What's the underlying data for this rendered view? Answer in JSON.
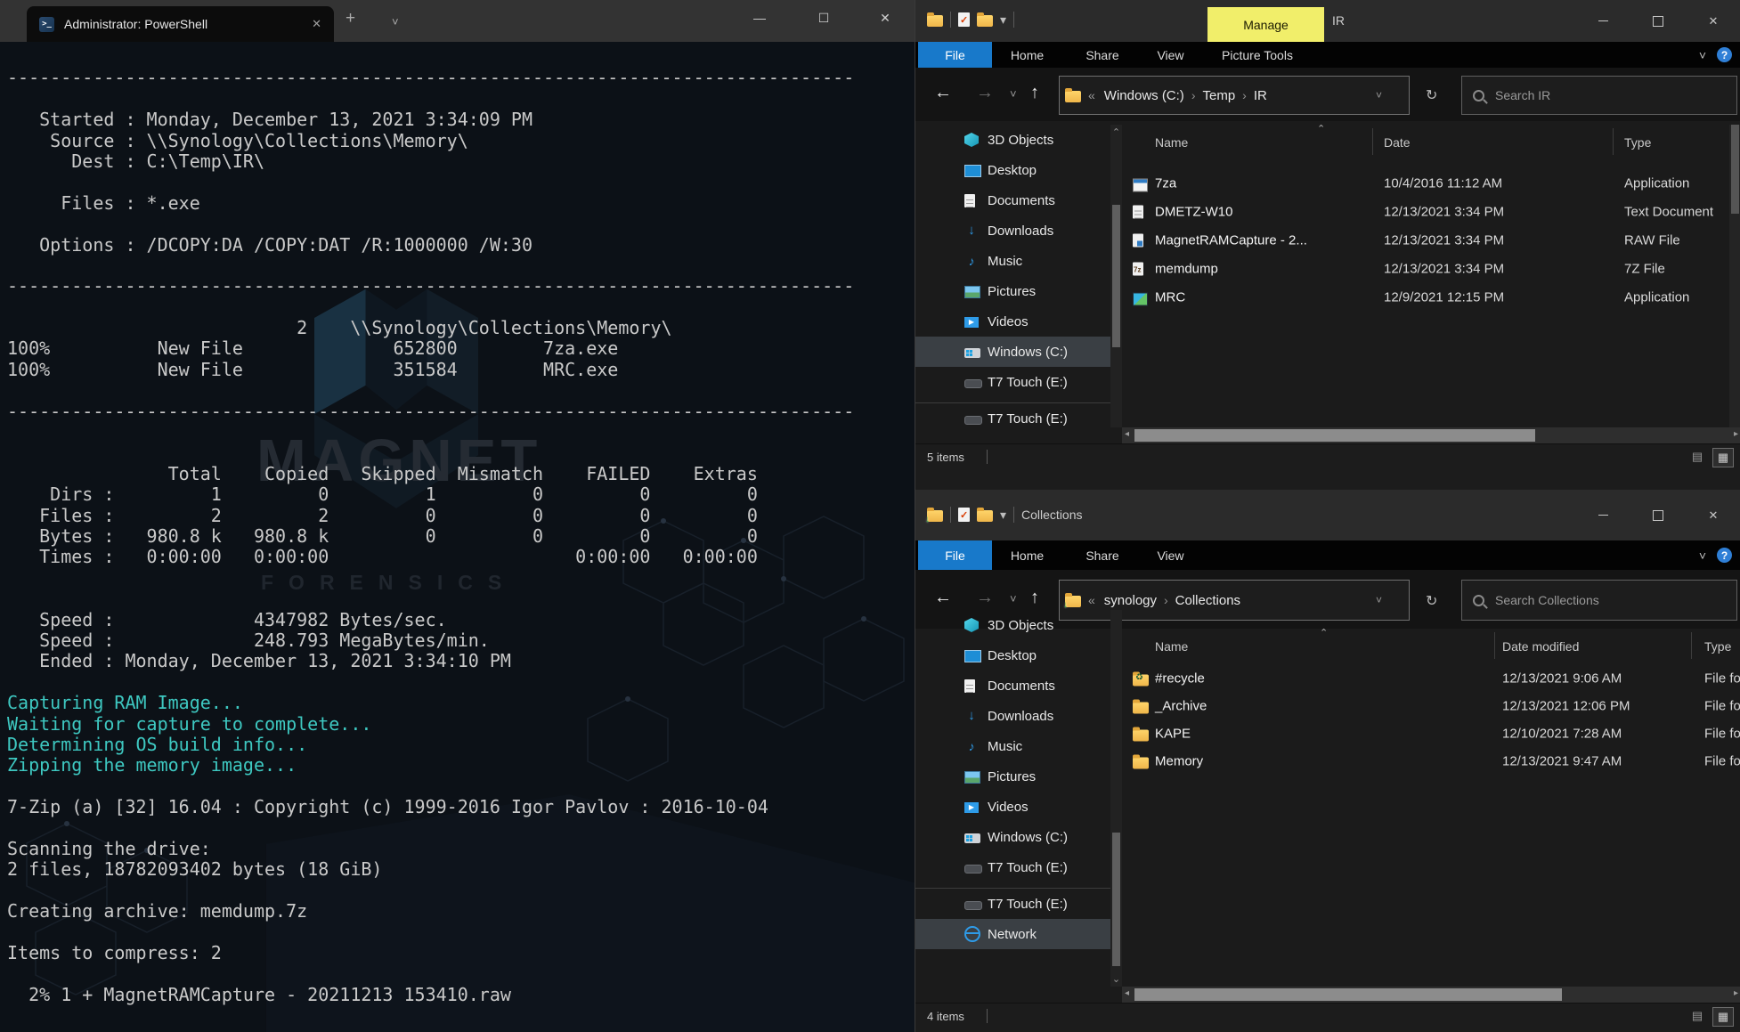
{
  "terminal": {
    "tab_title": "Administrator: PowerShell",
    "new_tab_label": "+",
    "tab_dropdown_label": "˅",
    "lines": [
      {
        "text": ""
      },
      {
        "text": "-------------------------------------------------------------------------------"
      },
      {
        "text": ""
      },
      {
        "text": "   Started : Monday, December 13, 2021 3:34:09 PM"
      },
      {
        "text": "    Source : \\\\Synology\\Collections\\Memory\\"
      },
      {
        "text": "      Dest : C:\\Temp\\IR\\"
      },
      {
        "text": ""
      },
      {
        "text": "     Files : *.exe"
      },
      {
        "text": ""
      },
      {
        "text": "   Options : /DCOPY:DA /COPY:DAT /R:1000000 /W:30"
      },
      {
        "text": ""
      },
      {
        "text": "-------------------------------------------------------------------------------"
      },
      {
        "text": ""
      },
      {
        "text": "                           2    \\\\Synology\\Collections\\Memory\\"
      },
      {
        "text": "100%          New File              652800        7za.exe"
      },
      {
        "text": "100%          New File              351584        MRC.exe"
      },
      {
        "text": ""
      },
      {
        "text": "-------------------------------------------------------------------------------"
      },
      {
        "text": ""
      },
      {
        "text": ""
      },
      {
        "text": "               Total    Copied   Skipped  Mismatch    FAILED    Extras"
      },
      {
        "text": "    Dirs :         1         0         1         0         0         0"
      },
      {
        "text": "   Files :         2         2         0         0         0         0"
      },
      {
        "text": "   Bytes :   980.8 k   980.8 k         0         0         0         0"
      },
      {
        "text": "   Times :   0:00:00   0:00:00                       0:00:00   0:00:00"
      },
      {
        "text": ""
      },
      {
        "text": ""
      },
      {
        "text": "   Speed :             4347982 Bytes/sec."
      },
      {
        "text": "   Speed :             248.793 MegaBytes/min."
      },
      {
        "text": "   Ended : Monday, December 13, 2021 3:34:10 PM"
      },
      {
        "text": ""
      },
      {
        "text": "Capturing RAM Image...",
        "color": "cyan"
      },
      {
        "text": "Waiting for capture to complete...",
        "color": "cyan"
      },
      {
        "text": "Determining OS build info...",
        "color": "cyan"
      },
      {
        "text": "Zipping the memory image...",
        "color": "cyan"
      },
      {
        "text": ""
      },
      {
        "text": "7-Zip (a) [32] 16.04 : Copyright (c) 1999-2016 Igor Pavlov : 2016-10-04"
      },
      {
        "text": ""
      },
      {
        "text": "Scanning the drive:"
      },
      {
        "text": "2 files, 18782093402 bytes (18 GiB)"
      },
      {
        "text": ""
      },
      {
        "text": "Creating archive: memdump.7z"
      },
      {
        "text": ""
      },
      {
        "text": "Items to compress: 2"
      },
      {
        "text": ""
      },
      {
        "text": "  2% 1 + MagnetRAMCapture - 20211213 153410.raw"
      }
    ]
  },
  "watermark": {
    "brand": "MAGNET",
    "sub": "FORENSICS"
  },
  "colors": {
    "accent_blue": "#1879ca",
    "manage_yellow": "#f1ee6a",
    "terminal_cyan": "#3ec8c1"
  },
  "explorer_top": {
    "title": "IR",
    "manage_label": "Manage",
    "ribbon_tabs": [
      {
        "label": "File",
        "primary": true
      },
      {
        "label": "Home"
      },
      {
        "label": "Share"
      },
      {
        "label": "View"
      },
      {
        "label": "Picture Tools"
      }
    ],
    "breadcrumb_prefix": "«",
    "breadcrumb": [
      {
        "label": "Windows (C:)"
      },
      {
        "label": "Temp"
      },
      {
        "label": "IR"
      }
    ],
    "search_placeholder": "Search IR",
    "columns": {
      "name": "Name",
      "date": "Date",
      "type": "Type"
    },
    "nav_items": [
      {
        "label": "3D Objects",
        "icon": "3d-objects"
      },
      {
        "label": "Desktop",
        "icon": "desktop"
      },
      {
        "label": "Documents",
        "icon": "documents"
      },
      {
        "label": "Downloads",
        "icon": "downloads"
      },
      {
        "label": "Music",
        "icon": "music"
      },
      {
        "label": "Pictures",
        "icon": "pictures"
      },
      {
        "label": "Videos",
        "icon": "videos"
      },
      {
        "label": "Windows (C:)",
        "icon": "drive-windows",
        "selected": true
      },
      {
        "label": "T7 Touch (E:)",
        "icon": "drive-external"
      },
      {
        "label": "T7 Touch (E:)",
        "icon": "drive-external",
        "group_start": true
      }
    ],
    "files": [
      {
        "name": "7za",
        "date": "10/4/2016 11:12 AM",
        "type": "Application",
        "icon": "app"
      },
      {
        "name": "DMETZ-W10",
        "date": "12/13/2021 3:34 PM",
        "type": "Text Document",
        "icon": "text-doc"
      },
      {
        "name": "MagnetRAMCapture - 2...",
        "date": "12/13/2021 3:34 PM",
        "type": "RAW File",
        "icon": "raw-file"
      },
      {
        "name": "memdump",
        "date": "12/13/2021 3:34 PM",
        "type": "7Z File",
        "icon": "archive-7z"
      },
      {
        "name": "MRC",
        "date": "12/9/2021 12:15 PM",
        "type": "Application",
        "icon": "app-color"
      }
    ],
    "status": "5 items"
  },
  "explorer_bottom": {
    "title": "Collections",
    "ribbon_tabs": [
      {
        "label": "File",
        "primary": true
      },
      {
        "label": "Home"
      },
      {
        "label": "Share"
      },
      {
        "label": "View"
      }
    ],
    "breadcrumb_prefix": "«",
    "breadcrumb": [
      {
        "label": "synology"
      },
      {
        "label": "Collections"
      }
    ],
    "search_placeholder": "Search Collections",
    "columns": {
      "name": "Name",
      "date": "Date modified",
      "type": "Type"
    },
    "nav_items": [
      {
        "label": "3D Objects",
        "icon": "3d-objects"
      },
      {
        "label": "Desktop",
        "icon": "desktop"
      },
      {
        "label": "Documents",
        "icon": "documents"
      },
      {
        "label": "Downloads",
        "icon": "downloads"
      },
      {
        "label": "Music",
        "icon": "music"
      },
      {
        "label": "Pictures",
        "icon": "pictures"
      },
      {
        "label": "Videos",
        "icon": "videos"
      },
      {
        "label": "Windows (C:)",
        "icon": "drive-windows"
      },
      {
        "label": "T7 Touch (E:)",
        "icon": "drive-external"
      },
      {
        "label": "T7 Touch (E:)",
        "icon": "drive-external",
        "group_start": true
      },
      {
        "label": "Network",
        "icon": "network",
        "selected": true
      }
    ],
    "files": [
      {
        "name": "#recycle",
        "date": "12/13/2021 9:06 AM",
        "type": "File fol",
        "icon": "folder-recycle"
      },
      {
        "name": "_Archive",
        "date": "12/13/2021 12:06 PM",
        "type": "File fol",
        "icon": "folder"
      },
      {
        "name": "KAPE",
        "date": "12/10/2021 7:28 AM",
        "type": "File fol",
        "icon": "folder"
      },
      {
        "name": "Memory",
        "date": "12/13/2021 9:47 AM",
        "type": "File fol",
        "icon": "folder"
      }
    ],
    "status": "4 items"
  }
}
